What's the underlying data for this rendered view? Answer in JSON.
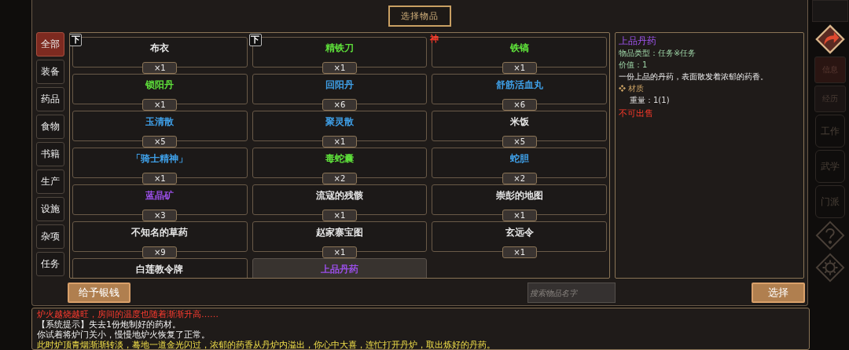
{
  "title": "选择物品",
  "categories": [
    {
      "label": "全部",
      "selected": true
    },
    {
      "label": "装备",
      "selected": false
    },
    {
      "label": "药品",
      "selected": false
    },
    {
      "label": "食物",
      "selected": false
    },
    {
      "label": "书籍",
      "selected": false
    },
    {
      "label": "生产",
      "selected": false
    },
    {
      "label": "设施",
      "selected": false
    },
    {
      "label": "杂项",
      "selected": false
    },
    {
      "label": "任务",
      "selected": false
    }
  ],
  "items": [
    {
      "name": "布衣",
      "color": "#e6e6e6",
      "count": "×1",
      "badge": {
        "text": "下",
        "color": "#ffffff"
      },
      "selected": false
    },
    {
      "name": "精铁刀",
      "color": "#5ee03a",
      "count": "×1",
      "badge": {
        "text": "下",
        "color": "#ffffff"
      },
      "selected": false
    },
    {
      "name": "铁镐",
      "color": "#5ee03a",
      "count": "×1",
      "badge": {
        "text": "神",
        "color": "#ff3a2a"
      },
      "selected": false
    },
    {
      "name": "锁阳丹",
      "color": "#5ee03a",
      "count": "×1",
      "selected": false
    },
    {
      "name": "回阳丹",
      "color": "#3fa0e8",
      "count": "×6",
      "selected": false
    },
    {
      "name": "舒筋活血丸",
      "color": "#3fa0e8",
      "count": "×6",
      "selected": false
    },
    {
      "name": "玉清散",
      "color": "#3fa0e8",
      "count": "×5",
      "selected": false
    },
    {
      "name": "聚灵散",
      "color": "#3fa0e8",
      "count": "×1",
      "selected": false
    },
    {
      "name": "米饭",
      "color": "#e6e6e6",
      "count": "×5",
      "selected": false
    },
    {
      "name": "「骑士精神」",
      "color": "#3fa0e8",
      "count": "×1",
      "selected": false
    },
    {
      "name": "毒蛇囊",
      "color": "#5ee03a",
      "count": "×2",
      "selected": false
    },
    {
      "name": "蛇胆",
      "color": "#3fa0e8",
      "count": "×2",
      "selected": false
    },
    {
      "name": "蓝晶矿",
      "color": "#9a4fe8",
      "count": "×3",
      "selected": false
    },
    {
      "name": "流寇的残骸",
      "color": "#e6e6e6",
      "count": "×1",
      "selected": false
    },
    {
      "name": "崇彭的地图",
      "color": "#e6e6e6",
      "count": "×1",
      "selected": false
    },
    {
      "name": "不知名的草药",
      "color": "#e6e6e6",
      "count": "×9",
      "selected": false
    },
    {
      "name": "赵家寨宝图",
      "color": "#e6e6e6",
      "count": "×1",
      "selected": false
    },
    {
      "name": "玄远令",
      "color": "#e6e6e6",
      "count": "×1",
      "selected": false
    },
    {
      "name": "白莲教令牌",
      "color": "#e6e6e6",
      "selected": false
    },
    {
      "name": "上品丹药",
      "color": "#9a4fe8",
      "selected": true
    }
  ],
  "detail": {
    "name": "上品丹药",
    "type": "物品类型：任务※任务",
    "value": "价值：1",
    "description": "一份上品的丹药，表面散发着浓郁的药香。",
    "section": "材质",
    "weight": "重量：1(1)",
    "notice": "不可出售"
  },
  "give_money_button": "给予银钱",
  "search": {
    "placeholder": "搜索物品名字"
  },
  "select_button": "选择",
  "log": [
    {
      "text": "炉火越烧越旺，房间的温度也随着渐渐升高……",
      "kind": "alert"
    },
    {
      "text": "【系统提示】失去1份炮制好的药材。",
      "kind": "normal"
    },
    {
      "text": "你试着将炉门关小，慢慢地炉火恢复了正常。",
      "kind": "normal"
    },
    {
      "text": "此时炉顶青烟渐渐转淡，蓦地一道金光闪过，浓郁的药香从丹炉内溢出，你心中大喜，连忙打开丹炉，取出炼好的丹药。",
      "kind": "story"
    }
  ],
  "rail": [
    {
      "kind": "blank"
    },
    {
      "kind": "share"
    },
    {
      "kind": "square",
      "label": "信息",
      "selected": true
    },
    {
      "kind": "square",
      "label": "经历",
      "selected": false
    },
    {
      "kind": "diamond",
      "label": "工作"
    },
    {
      "kind": "diamond",
      "label": "武学"
    },
    {
      "kind": "diamond",
      "label": "门派"
    },
    {
      "kind": "help"
    },
    {
      "kind": "gear"
    }
  ]
}
